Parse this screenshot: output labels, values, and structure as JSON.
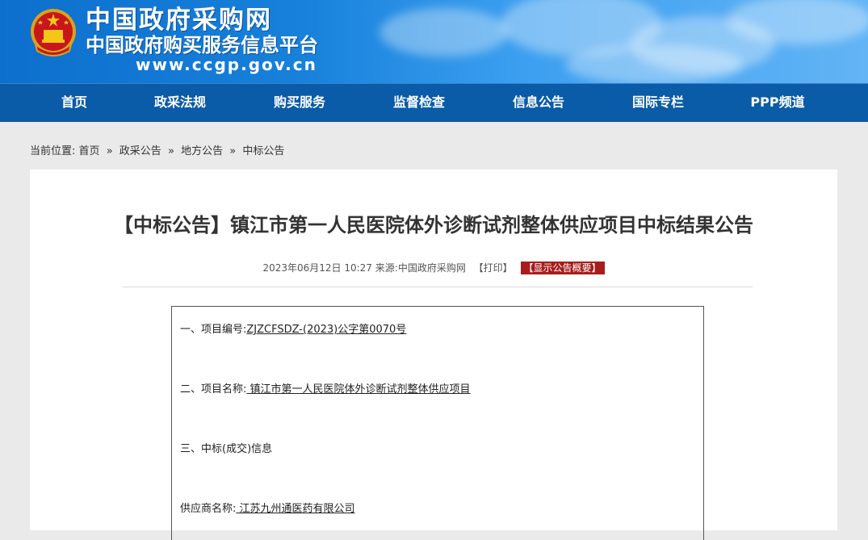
{
  "header": {
    "site_title": "中国政府采购网",
    "site_subtitle": "中国政府购买服务信息平台",
    "site_url": "www.ccgp.gov.cn",
    "emblem_icon": "national-emblem-icon"
  },
  "nav": {
    "items": [
      {
        "label": "首页"
      },
      {
        "label": "政采法规"
      },
      {
        "label": "购买服务"
      },
      {
        "label": "监督检查"
      },
      {
        "label": "信息公告"
      },
      {
        "label": "国际专栏"
      },
      {
        "label": "PPP频道"
      }
    ]
  },
  "breadcrumb": {
    "prefix": "当前位置:",
    "items": [
      "首页",
      "政采公告",
      "地方公告",
      "中标公告"
    ],
    "separator": "»"
  },
  "article": {
    "title": "【中标公告】镇江市第一人民医院体外诊断试剂整体供应项目中标结果公告",
    "meta": {
      "datetime": "2023年06月12日 10:27",
      "source_label": "来源:",
      "source": "中国政府采购网",
      "print_label": "【打印】",
      "summary_label": "【显示公告概要】"
    },
    "body": {
      "line1_label": "一、项目编号:",
      "line1_value": "ZJZCFSDZ-(2023)公字第0070号",
      "line2_label": "二、项目名称:",
      "line2_value": " 镇江市第一人民医院体外诊断试剂整体供应项目",
      "line3_label": "三、中标(成交)信息",
      "line4_label": "供应商名称:",
      "line4_value": " 江苏九州通医药有限公司"
    }
  },
  "colors": {
    "nav_bg": "#0a5ba8",
    "banner_blue": "#1781db",
    "summary_red": "#a81c1c"
  }
}
